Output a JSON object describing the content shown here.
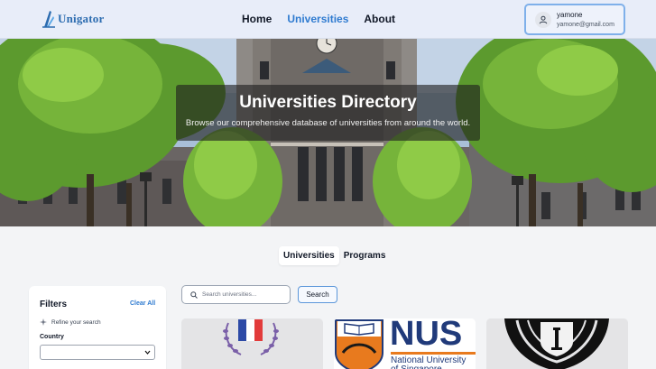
{
  "header": {
    "logo_text": "Unigator",
    "nav": [
      {
        "label": "Home",
        "active": false
      },
      {
        "label": "Universities",
        "active": true
      },
      {
        "label": "About",
        "active": false
      }
    ],
    "user": {
      "name": "yamone",
      "email": "yamone@gmail.com"
    }
  },
  "hero": {
    "title": "Universities Directory",
    "subtitle": "Browse our comprehensive database of universities from around the world."
  },
  "tabs": [
    {
      "label": "Universities",
      "active": true
    },
    {
      "label": "Programs",
      "active": false
    }
  ],
  "filters": {
    "title": "Filters",
    "clear_label": "Clear All",
    "refine_label": "Refine your search",
    "country_label": "Country",
    "country_value": ""
  },
  "search": {
    "placeholder": "Search universities...",
    "button_label": "Search"
  },
  "cards": [
    {
      "logo": "laurel-tricolor-crest"
    },
    {
      "logo_text": "NUS",
      "logo_sub": "National University of Singapore"
    },
    {
      "logo": "black-torch-crest"
    }
  ],
  "colors": {
    "accent": "#2f7bd0",
    "header_bg": "#e8edf9",
    "page_bg": "#f3f4f6"
  }
}
